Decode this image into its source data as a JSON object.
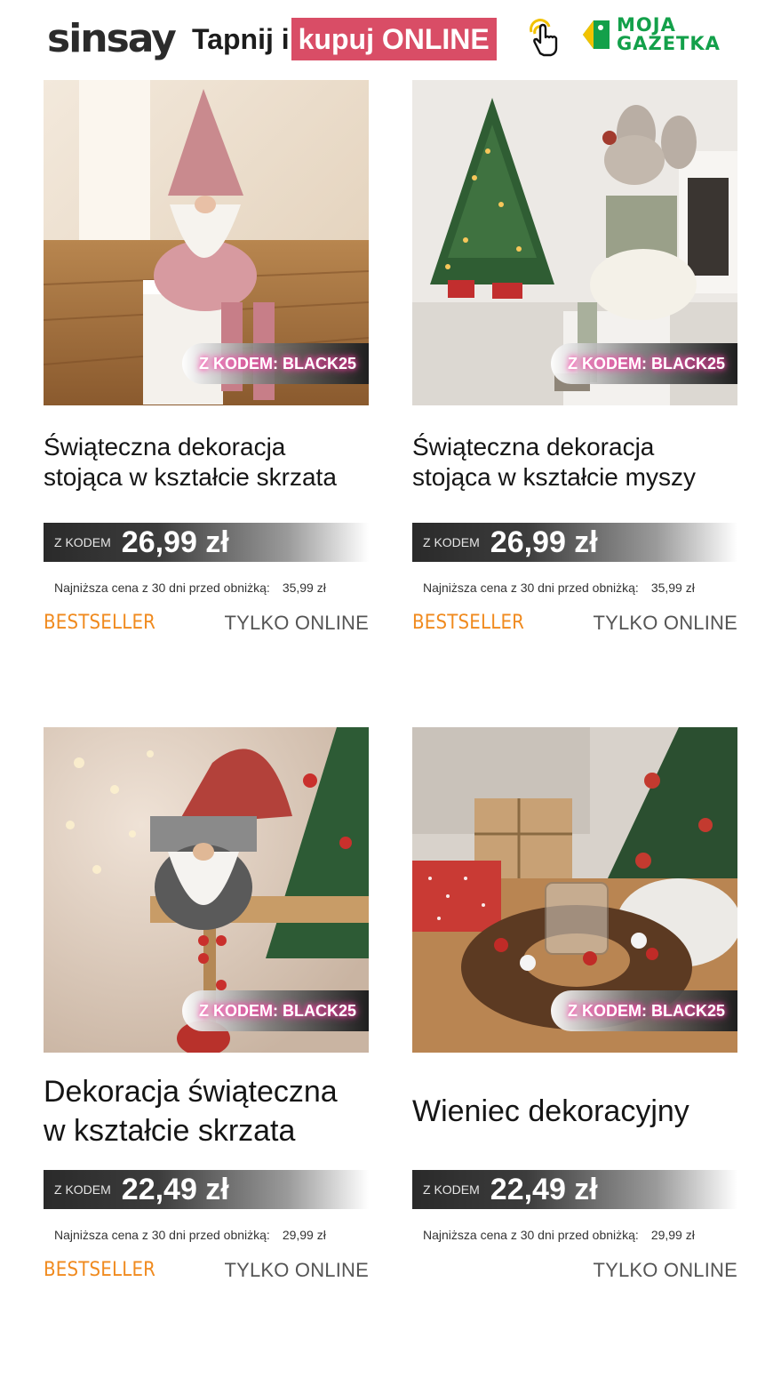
{
  "header": {
    "logo_text": "sinsay",
    "tagline_prefix": "Tapnij i",
    "tagline_highlight": "kupuj ONLINE",
    "tap_icon": "tap-hand-icon",
    "partner_logo_line1": "MOJA",
    "partner_logo_line2": "GAZETKA",
    "colors": {
      "highlight": "#d94d66",
      "partner": "#13a04a"
    }
  },
  "products": [
    {
      "image_icon": "pink-gnome-image",
      "badge": "Z KODEM: BLACK25",
      "title_line1": "Świąteczna dekoracja",
      "title_line2": "stojąca w kształcie skrzata",
      "price_label": "Z KODEM",
      "price": "26,99 zł",
      "lowest_label": "Najniższa cena z 30 dni przed obniżką:",
      "lowest_value": "35,99 zł",
      "tag_left": "BESTSELLER",
      "tag_right": "TYLKO ONLINE"
    },
    {
      "image_icon": "mouse-figure-image",
      "badge": "Z KODEM: BLACK25",
      "title_line1": "Świąteczna dekoracja",
      "title_line2": "stojąca w kształcie myszy",
      "price_label": "Z KODEM",
      "price": "26,99 zł",
      "lowest_label": "Najniższa cena z 30 dni przed obniżką:",
      "lowest_value": "35,99 zł",
      "tag_left": "BESTSELLER",
      "tag_right": "TYLKO ONLINE"
    },
    {
      "image_icon": "red-gnome-image",
      "badge": "Z KODEM: BLACK25",
      "title_line1": "Dekoracja świąteczna",
      "title_line2": "w kształcie skrzata",
      "price_label": "Z KODEM",
      "price": "22,49 zł",
      "lowest_label": "Najniższa cena z 30 dni przed obniżką:",
      "lowest_value": "29,99 zł",
      "tag_left": "BESTSELLER",
      "tag_right": "TYLKO ONLINE"
    },
    {
      "image_icon": "pinecone-wreath-image",
      "badge": "Z KODEM: BLACK25",
      "title_line1": "Wieniec dekoracyjny",
      "price_label": "Z KODEM",
      "price": "22,49 zł",
      "lowest_label": "Najniższa cena z 30 dni przed obniżką:",
      "lowest_value": "29,99 zł",
      "tag_right": "TYLKO ONLINE"
    }
  ],
  "colors": {
    "bestseller": "#f08a1e",
    "online": "#555555",
    "badge_glow": "#ff3fa8"
  }
}
